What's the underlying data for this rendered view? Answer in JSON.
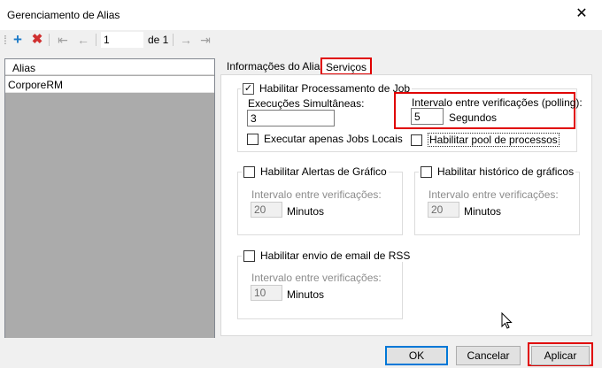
{
  "window": {
    "title": "Gerenciamento de Alias"
  },
  "toolbar": {
    "page_value": "1",
    "page_of": "de 1"
  },
  "list": {
    "header": "Alias",
    "items": [
      "CorporeRM"
    ]
  },
  "tabs": [
    {
      "label": "Informações do Alias"
    },
    {
      "label": "Serviços"
    }
  ],
  "job": {
    "enable_label": "Habilitar Processamento de Job",
    "exec_label": "Execuções Simultâneas:",
    "exec_value": "3",
    "polling_label": "Intervalo entre verificações (polling):",
    "polling_value": "5",
    "polling_unit": "Segundos",
    "local_jobs_label": "Executar apenas Jobs Locais",
    "pool_label": "Habilitar pool de processos"
  },
  "chart_alerts": {
    "enable_label": "Habilitar Alertas de Gráfico",
    "interval_label": "Intervalo entre verificações:",
    "interval_value": "20",
    "unit": "Minutos"
  },
  "chart_history": {
    "enable_label": "Habilitar histórico de gráficos",
    "interval_label": "Intervalo entre verificações:",
    "interval_value": "20",
    "unit": "Minutos"
  },
  "rss": {
    "enable_label": "Habilitar envio de email de RSS",
    "interval_label": "Intervalo entre verificações:",
    "interval_value": "10",
    "unit": "Minutos"
  },
  "buttons": {
    "ok": "OK",
    "cancel": "Cancelar",
    "apply": "Aplicar"
  },
  "colors": {
    "highlight": "#e00000",
    "add": "#1e7bc8",
    "delete": "#d03030"
  },
  "icons": [
    "close-icon",
    "add-icon",
    "delete-icon",
    "first-page-icon",
    "prev-page-icon",
    "next-page-icon",
    "last-page-icon",
    "checkmark-icon",
    "mouse-pointer-icon"
  ]
}
